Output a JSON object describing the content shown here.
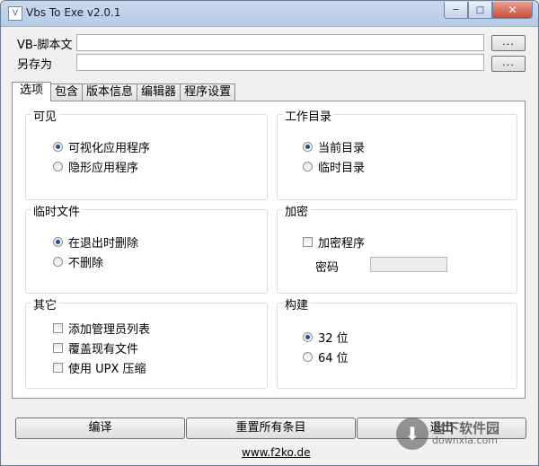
{
  "window": {
    "title": "Vbs To Exe v2.0.1",
    "controls": {
      "minimize": "─",
      "maximize": "□",
      "close": "✕"
    }
  },
  "fields": {
    "script_label": "VB-脚本文",
    "script_value": "",
    "script_browse": "...",
    "saveas_label": "另存为",
    "saveas_value": "",
    "saveas_browse": "..."
  },
  "tabs": [
    {
      "label": "选项",
      "active": true
    },
    {
      "label": "包含"
    },
    {
      "label": "版本信息"
    },
    {
      "label": "编辑器"
    },
    {
      "label": "程序设置"
    }
  ],
  "groups": {
    "visible": {
      "title": "可见",
      "options": [
        {
          "label": "可视化应用程序",
          "checked": true
        },
        {
          "label": "隐形应用程序",
          "checked": false
        }
      ]
    },
    "workdir": {
      "title": "工作目录",
      "options": [
        {
          "label": "当前目录",
          "checked": true
        },
        {
          "label": "临时目录",
          "checked": false
        }
      ]
    },
    "tempfiles": {
      "title": "临时文件",
      "options": [
        {
          "label": "在退出时删除",
          "checked": true
        },
        {
          "label": "不删除",
          "checked": false
        }
      ]
    },
    "encryption": {
      "title": "加密",
      "encrypt_label": "加密程序",
      "encrypt_checked": false,
      "password_label": "密码",
      "password_value": ""
    },
    "other": {
      "title": "其它",
      "options": [
        {
          "label": "添加管理员列表",
          "checked": false
        },
        {
          "label": "覆盖现有文件",
          "checked": false
        },
        {
          "label": "使用 UPX 压缩",
          "checked": false
        }
      ]
    },
    "build": {
      "title": "构建",
      "options": [
        {
          "label": "32 位",
          "checked": true
        },
        {
          "label": "64 位",
          "checked": false
        }
      ]
    }
  },
  "buttons": {
    "compile": "编译",
    "reset": "重置所有条目",
    "exit": "退出"
  },
  "footer": {
    "link": "www.f2ko.de"
  },
  "watermark": {
    "main": "当下软件园",
    "sub": "downxia.com"
  }
}
